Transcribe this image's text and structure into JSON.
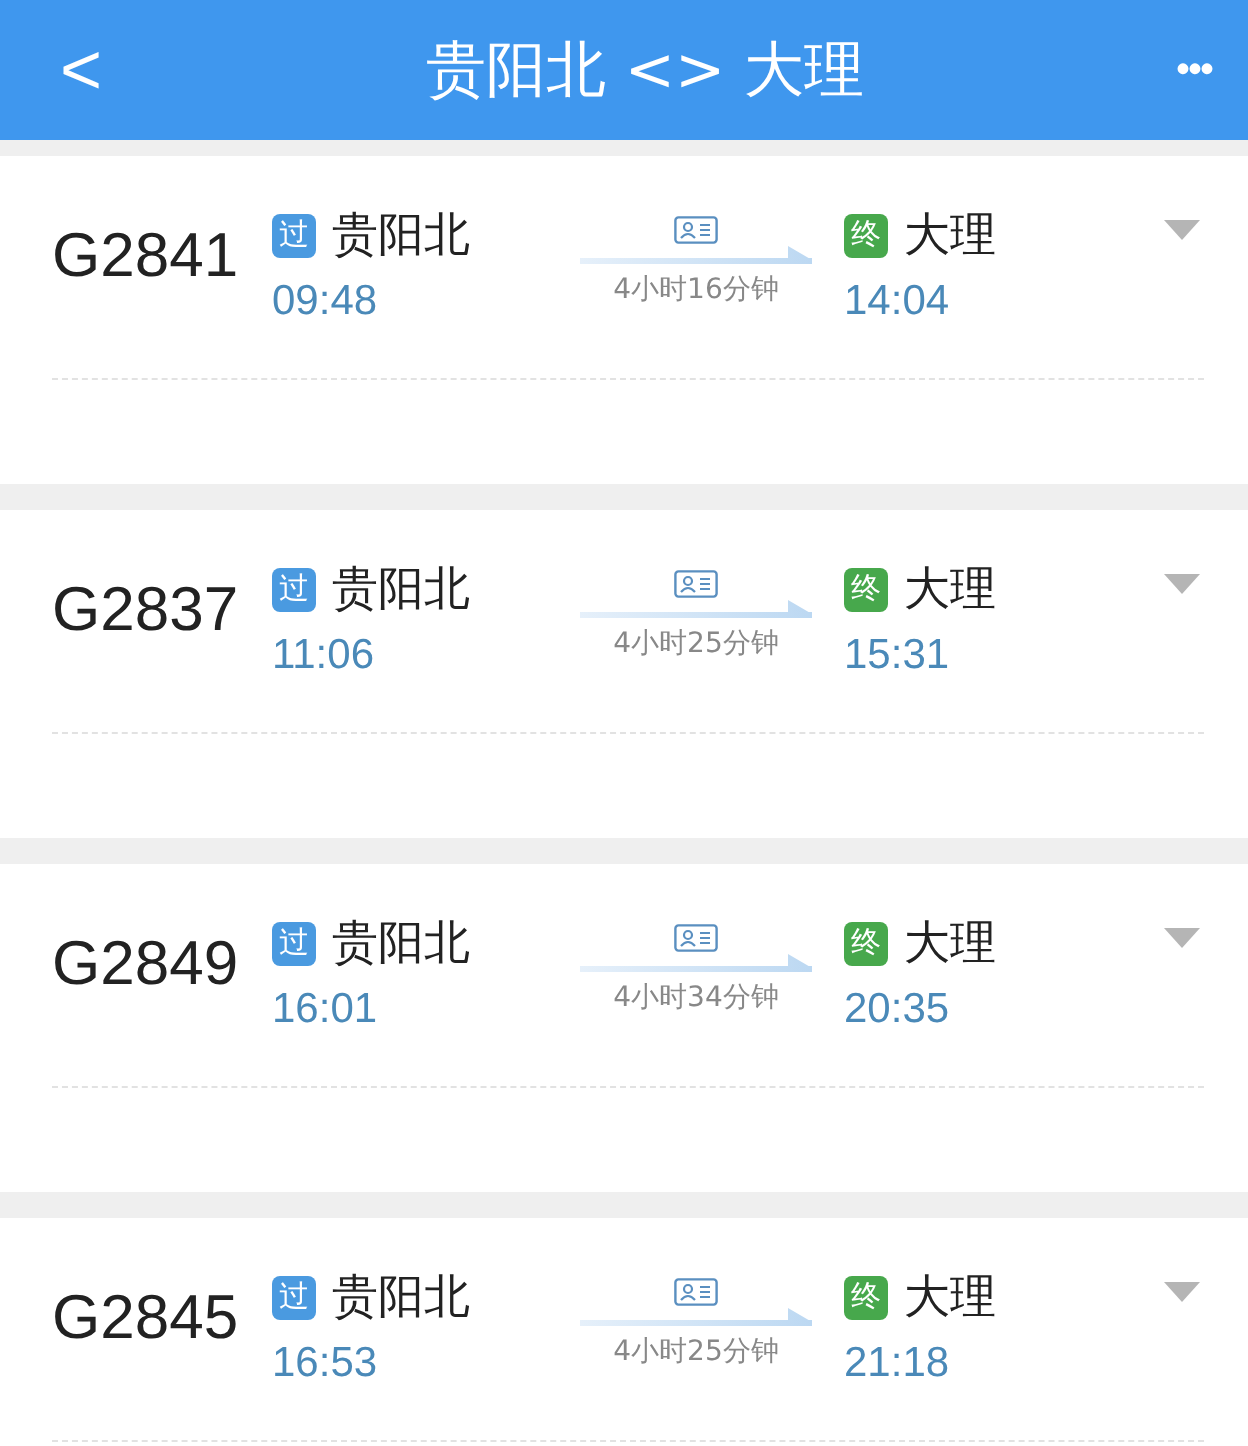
{
  "header": {
    "back": "<",
    "title": "贵阳北 <> 大理",
    "more": "•••"
  },
  "trains": [
    {
      "number": "G2841",
      "from": {
        "badge": "过",
        "kind": "pass",
        "station": "贵阳北",
        "time": "09:48"
      },
      "duration": "4小时16分钟",
      "to": {
        "badge": "终",
        "kind": "end",
        "station": "大理",
        "time": "14:04"
      }
    },
    {
      "number": "G2837",
      "from": {
        "badge": "过",
        "kind": "pass",
        "station": "贵阳北",
        "time": "11:06"
      },
      "duration": "4小时25分钟",
      "to": {
        "badge": "终",
        "kind": "end",
        "station": "大理",
        "time": "15:31"
      }
    },
    {
      "number": "G2849",
      "from": {
        "badge": "过",
        "kind": "pass",
        "station": "贵阳北",
        "time": "16:01"
      },
      "duration": "4小时34分钟",
      "to": {
        "badge": "终",
        "kind": "end",
        "station": "大理",
        "time": "20:35"
      }
    },
    {
      "number": "G2845",
      "from": {
        "badge": "过",
        "kind": "pass",
        "station": "贵阳北",
        "time": "16:53"
      },
      "duration": "4小时25分钟",
      "to": {
        "badge": "终",
        "kind": "end",
        "station": "大理",
        "time": "21:18"
      }
    }
  ]
}
